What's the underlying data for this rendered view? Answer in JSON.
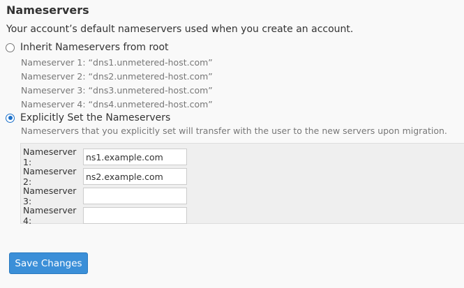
{
  "section": {
    "title": "Nameservers",
    "description": "Your account’s default nameservers used when you create an account."
  },
  "inherit": {
    "label": "Inherit Nameservers from root",
    "checked": false,
    "nameservers": [
      "Nameserver 1: “dns1.unmetered-host.com”",
      "Nameserver 2: “dns2.unmetered-host.com”",
      "Nameserver 3: “dns3.unmetered-host.com”",
      "Nameserver 4: “dns4.unmetered-host.com”"
    ]
  },
  "explicit": {
    "label": "Explicitly Set the Nameservers",
    "checked": true,
    "help": "Nameservers that you explicitly set will transfer with the user to the new servers upon migration.",
    "fields": [
      {
        "label": "Nameserver 1:",
        "value": "ns1.example.com"
      },
      {
        "label": "Nameserver 2:",
        "value": "ns2.example.com"
      },
      {
        "label": "Nameserver 3:",
        "value": ""
      },
      {
        "label": "Nameserver 4:",
        "value": ""
      }
    ]
  },
  "actions": {
    "save_label": "Save Changes"
  },
  "colors": {
    "accent": "#3b8fd8",
    "radio_checked": "#1a6fc9"
  }
}
